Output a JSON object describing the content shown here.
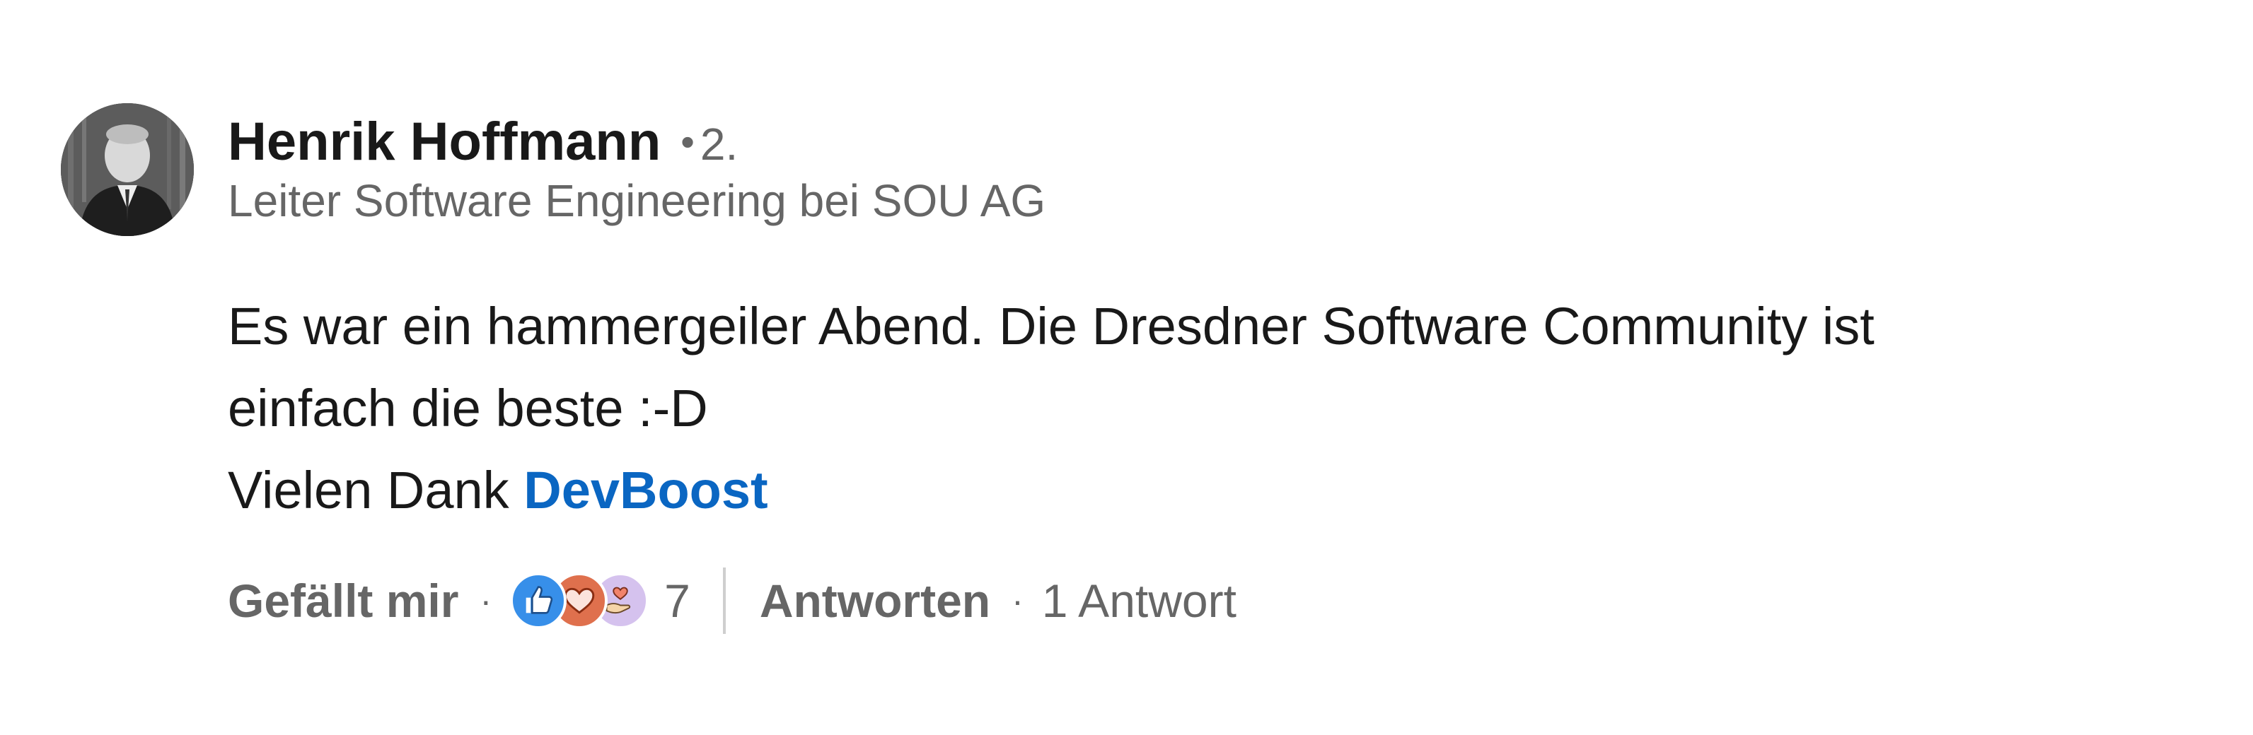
{
  "comment": {
    "author": {
      "name": "Henrik Hoffmann",
      "degree_separator": "•",
      "degree": "2.",
      "headline": "Leiter Software Engineering bei SOU AG",
      "avatar_icon": "profile-photo"
    },
    "text": {
      "line1": "Es war ein hammergeiler Abend. Die Dresdner Software Community ist",
      "line2": "einfach die beste :-D",
      "line3_prefix": "Vielen Dank ",
      "mention": "DevBoost"
    },
    "actions": {
      "like_label": "Gefällt mir",
      "dot": "·",
      "reactions": [
        {
          "type": "like",
          "icon": "thumbs-up-icon",
          "color": "#378fe9"
        },
        {
          "type": "love",
          "icon": "heart-icon",
          "color": "#df704d"
        },
        {
          "type": "support",
          "icon": "heart-hand-icon",
          "color": "#d5c2ee"
        }
      ],
      "reaction_count": "7",
      "reply_label": "Antworten",
      "reply_dot": "·",
      "reply_count": "1 Antwort"
    },
    "colors": {
      "mention": "#0a66c2",
      "secondary_text": "#666666",
      "primary_text": "#191919"
    }
  }
}
